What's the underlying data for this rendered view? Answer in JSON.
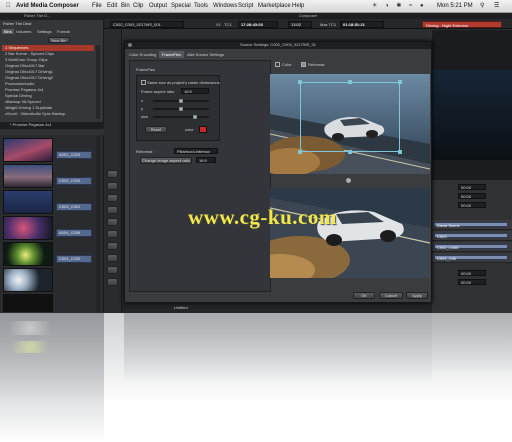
{
  "menubar": {
    "app_name": "Avid Media Composer",
    "items": [
      "File",
      "Edit",
      "Bin",
      "Clip",
      "Output",
      "Special",
      "Tools",
      "Windows",
      "Script",
      "Marketplace",
      "Help"
    ],
    "clock": "Mon 5:21 PM"
  },
  "project": {
    "window_title": "Fisher The D...",
    "title": "Fisher The Deal",
    "tabs": [
      "Bins",
      "Volumes",
      "Settings",
      "Format"
    ],
    "new_bin_label": "New Bin",
    "bins": [
      "1 Sequences",
      "2 Bar Scene - Synced Clips",
      "3 MultiCam Group Clips",
      "Original Ohio4017 Bar",
      "Original Ohio4017 Driving1",
      "Original Ohio4017 Driving2",
      "ProductionAudio",
      "Promise Pegasus 4x1",
      "Special Driving",
      "vBackup VA Synced",
      "vBright Driving 1 Duplicate",
      "zScroll - VideoAudio Sync Backup",
      "* Promise Pegasus 4x1"
    ],
    "selected_bin_index": 0
  },
  "bin_window": {
    "title": "* Promise Pegasus 4x1",
    "clips": [
      "A001_C003",
      "C002_C003",
      "C003_C001",
      "A004_C006",
      "C001_C005"
    ]
  },
  "composer": {
    "window_title": "Composer",
    "source_clip": "C002_C003_0217WS_001",
    "tc_label_1": "V1",
    "tc_label_2": "TC1",
    "source_tc": "17:28:43:03",
    "record_tc_a": "13:02",
    "record_tc_label": "Mas TC1",
    "record_tc": "01:18:51:21",
    "sequence_name": "Driving - Night Exteriors"
  },
  "dialog": {
    "title": "Source Settings: C002_C003_0217WS_01",
    "tabs": [
      "Color Encoding",
      "FrameFlex",
      "Alkit Source Settings"
    ],
    "active_tab": 1,
    "section_label": "FrameFlex",
    "same_size_label": "Same size as project's raster dimensions",
    "frame_ratio_label": "Frame aspect ratio",
    "frame_ratio_value": "16:9",
    "x_label": "x",
    "y_label": "y",
    "size_label": "size",
    "reset_button": "Reset",
    "color_label": "color",
    "reformat_label": "Reformat",
    "reformat_value": "Pillarbox/Letterbox",
    "change_ratio_label": "Change image aspect ratio",
    "change_ratio_value": "16:9",
    "preview_toggle_a": "Color",
    "preview_toggle_b": "Reformat",
    "ok_button": "OK",
    "cancel_button": "Cancel",
    "apply_button": "Apply"
  },
  "timeline": {
    "right_timecodes": [
      "00:00",
      "00:00",
      "00:00",
      "00:00",
      "00:00"
    ],
    "clip_labels": [
      "Zama Scene",
      "C003",
      "C002_C003",
      "C001_C00"
    ],
    "bottom_label": "Untitled"
  },
  "watermark": "www.cg-ku.com",
  "colors": {
    "ui_dark": "#2d2e30",
    "selection_red": "#a53a2a",
    "bin_clip_blue": "#55698c",
    "watermark_yellow": "#f1e84a",
    "record_red": "#cc2a2a"
  }
}
